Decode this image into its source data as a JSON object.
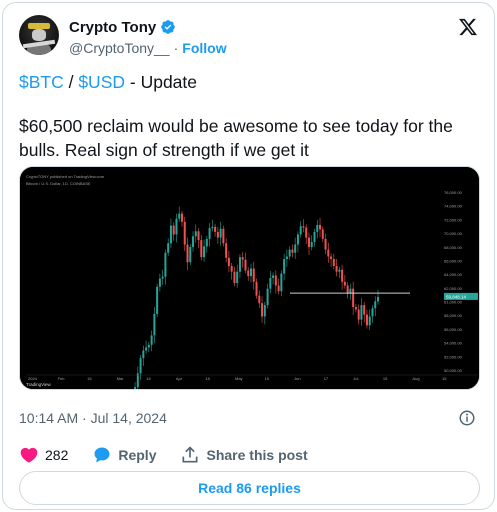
{
  "author": {
    "name": "Crypto Tony",
    "handle": "@CryptoTony__",
    "separator": "·",
    "follow_label": "Follow"
  },
  "tweet": {
    "line1_cash1": "$BTC",
    "line1_sep": " / ",
    "line1_cash2": "$USD",
    "line1_rest": " - Update",
    "line2": "$60,500 reclaim would be awesome to see today for the bulls. Real sign of strength if we get it"
  },
  "timestamp": "10:14 AM · Jul 14, 2024",
  "actions": {
    "likes": "282",
    "reply_label": "Reply",
    "share_label": "Share this post"
  },
  "read_replies_label": "Read 86 replies",
  "colors": {
    "accent": "#1d9bf0",
    "like": "#f91880",
    "bull_candle": "#26a69a",
    "bear_candle": "#ef5350"
  },
  "icons": [
    "verified-badge-icon",
    "x-logo-icon",
    "info-icon",
    "heart-icon",
    "reply-bubble-icon",
    "share-icon"
  ],
  "chart_data": {
    "type": "candlestick",
    "symbol_label": "Bitcoin / U.S. Dollar, 1D, COINBASE",
    "x_tick_labels": [
      "2024",
      "Feb",
      "15",
      "Mar",
      "15",
      "Apr",
      "15",
      "May",
      "15",
      "Jun",
      "17",
      "Jul",
      "15",
      "Aug",
      "15"
    ],
    "y_tick_labels": [
      "76,000.00",
      "74,000.00",
      "72,000.00",
      "70,000.00",
      "68,000.00",
      "66,000.00",
      "64,000.00",
      "62,000.00",
      "61,000.00",
      "58,000.00",
      "56,000.00",
      "54,000.00",
      "52,000.00",
      "50,000.00"
    ],
    "ylim": [
      48000,
      77000
    ],
    "horizontal_level": 60500,
    "last_price_label": "59,848.14",
    "level_label": "60,500.00",
    "watermark": "TradingView",
    "closes": [
      42500,
      43200,
      42800,
      44100,
      45600,
      47800,
      50200,
      51400,
      51900,
      52300,
      53800,
      57200,
      61500,
      62800,
      63100,
      66900,
      68400,
      71200,
      69800,
      72300,
      73100,
      71800,
      68200,
      65400,
      67800,
      69500,
      70300,
      68900,
      66200,
      67900,
      69100,
      70800,
      71000,
      70200,
      69300,
      70700,
      68400,
      66100,
      64800,
      63900,
      62100,
      63900,
      66200,
      65800,
      64100,
      63200,
      64400,
      62300,
      60100,
      58900,
      56800,
      58600,
      61200,
      62900,
      63300,
      61700,
      60800,
      63600,
      65900,
      66300,
      67400,
      66900,
      68200,
      69800,
      71100,
      70900,
      69300,
      67800,
      68600,
      70200,
      71300,
      70600,
      69100,
      67400,
      66300,
      65900,
      64800,
      63900,
      64200,
      62300,
      61700,
      60400,
      61200,
      58300,
      57900,
      56300,
      58600,
      57100,
      55400,
      56800,
      58100,
      59200,
      59900
    ]
  }
}
